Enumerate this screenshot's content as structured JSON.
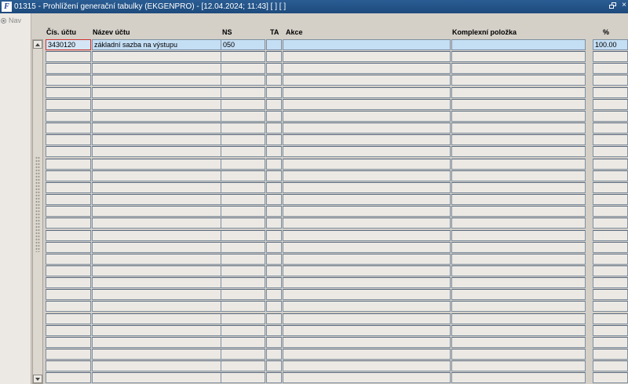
{
  "window": {
    "title": "01315 - Prohlížení generační tabulky (EKGENPRO) - [12.04.2024; 11:43]  [ ]  [ ]",
    "app_icon_text": "F",
    "close_glyph": "×"
  },
  "nav": {
    "label": "Nav"
  },
  "columns": [
    {
      "key": "cis_uctu",
      "label": "Čís. účtu"
    },
    {
      "key": "nazev_uctu",
      "label": "Název účtu"
    },
    {
      "key": "ns",
      "label": "NS"
    },
    {
      "key": "ta",
      "label": "TA"
    },
    {
      "key": "akce",
      "label": "Akce"
    },
    {
      "key": "komplexni_polozka",
      "label": "Komplexní položka"
    },
    {
      "key": "procento",
      "label": "%"
    }
  ],
  "rows": [
    [
      "3430120",
      "základní sazba na výstupu",
      "050",
      "",
      "",
      "",
      "100.00"
    ],
    [
      "",
      "",
      "",
      "",
      "",
      "",
      ""
    ],
    [
      "",
      "",
      "",
      "",
      "",
      "",
      ""
    ],
    [
      "",
      "",
      "",
      "",
      "",
      "",
      ""
    ],
    [
      "",
      "",
      "",
      "",
      "",
      "",
      ""
    ],
    [
      "",
      "",
      "",
      "",
      "",
      "",
      ""
    ],
    [
      "",
      "",
      "",
      "",
      "",
      "",
      ""
    ],
    [
      "",
      "",
      "",
      "",
      "",
      "",
      ""
    ],
    [
      "",
      "",
      "",
      "",
      "",
      "",
      ""
    ],
    [
      "",
      "",
      "",
      "",
      "",
      "",
      ""
    ],
    [
      "",
      "",
      "",
      "",
      "",
      "",
      ""
    ],
    [
      "",
      "",
      "",
      "",
      "",
      "",
      ""
    ],
    [
      "",
      "",
      "",
      "",
      "",
      "",
      ""
    ],
    [
      "",
      "",
      "",
      "",
      "",
      "",
      ""
    ],
    [
      "",
      "",
      "",
      "",
      "",
      "",
      ""
    ],
    [
      "",
      "",
      "",
      "",
      "",
      "",
      ""
    ],
    [
      "",
      "",
      "",
      "",
      "",
      "",
      ""
    ],
    [
      "",
      "",
      "",
      "",
      "",
      "",
      ""
    ],
    [
      "",
      "",
      "",
      "",
      "",
      "",
      ""
    ],
    [
      "",
      "",
      "",
      "",
      "",
      "",
      ""
    ],
    [
      "",
      "",
      "",
      "",
      "",
      "",
      ""
    ],
    [
      "",
      "",
      "",
      "",
      "",
      "",
      ""
    ],
    [
      "",
      "",
      "",
      "",
      "",
      "",
      ""
    ],
    [
      "",
      "",
      "",
      "",
      "",
      "",
      ""
    ],
    [
      "",
      "",
      "",
      "",
      "",
      "",
      ""
    ],
    [
      "",
      "",
      "",
      "",
      "",
      "",
      ""
    ],
    [
      "",
      "",
      "",
      "",
      "",
      "",
      ""
    ],
    [
      "",
      "",
      "",
      "",
      "",
      "",
      ""
    ],
    [
      "",
      "",
      "",
      "",
      "",
      "",
      ""
    ]
  ],
  "icons": {
    "app": "app-logo-icon",
    "restore": "restore-window-icon",
    "close": "close-icon",
    "nav": "radio-icon",
    "scroll_up": "scroll-up-arrow-icon",
    "scroll_down": "scroll-down-arrow-icon"
  },
  "colors": {
    "titlebar": "#1f4e84",
    "active_row": "#c4def4",
    "focus_border": "#d03030",
    "field": "#ece9e4",
    "background": "#d4d0c8"
  }
}
